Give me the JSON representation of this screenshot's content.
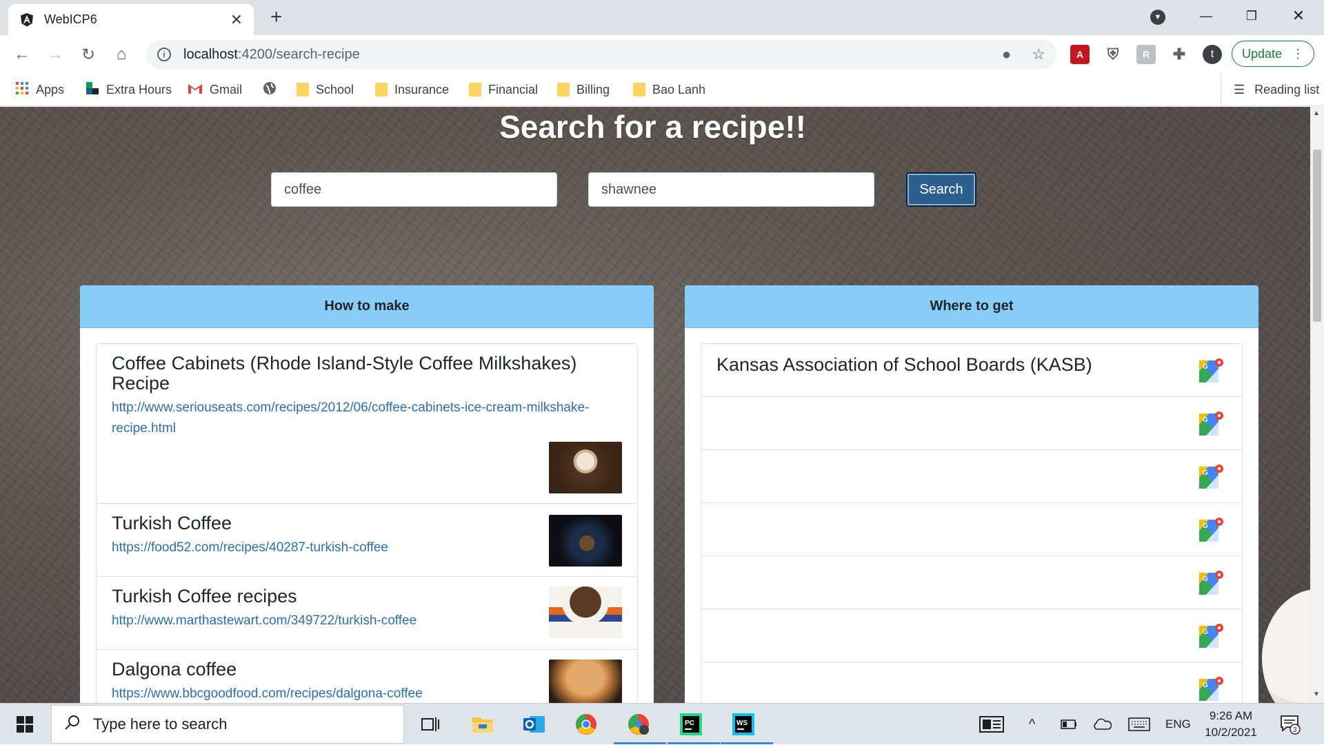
{
  "browser": {
    "tab_title": "WebICP6",
    "url_host": "localhost",
    "url_rest": ":4200/search-recipe",
    "update_label": "Update",
    "avatar_letter": "t"
  },
  "bookmarks": [
    {
      "label": "Apps",
      "icon": "apps-grid-icon"
    },
    {
      "label": "Extra Hours",
      "icon": "app-icon"
    },
    {
      "label": "Gmail",
      "icon": "gmail-icon"
    },
    {
      "label": "",
      "icon": "globe-icon"
    },
    {
      "label": "School",
      "icon": "folder-icon"
    },
    {
      "label": "Insurance",
      "icon": "folder-icon"
    },
    {
      "label": "Financial",
      "icon": "folder-icon"
    },
    {
      "label": "Billing",
      "icon": "folder-icon"
    },
    {
      "label": "Bao Lanh",
      "icon": "folder-icon"
    }
  ],
  "reading_list": "Reading list",
  "page": {
    "title": "Search for a recipe!!",
    "recipe_query": "coffee",
    "location_query": "shawnee",
    "search_label": "Search"
  },
  "how_to_make": {
    "header": "How to make",
    "recipes": [
      {
        "title": "Coffee Cabinets (Rhode Island-Style Coffee Milkshakes) Recipe",
        "url": "http://www.seriouseats.com/recipes/2012/06/coffee-cabinets-ice-cream-milkshake-recipe.html",
        "thumb": "milkshake-photo"
      },
      {
        "title": "Turkish Coffee",
        "url": "https://food52.com/recipes/40287-turkish-coffee",
        "thumb": "turkish-coffee-cup-photo"
      },
      {
        "title": "Turkish Coffee recipes",
        "url": "http://www.marthastewart.com/349722/turkish-coffee",
        "thumb": "coffee-cup-photo"
      },
      {
        "title": "Dalgona coffee",
        "url": "https://www.bbcgoodfood.com/recipes/dalgona-coffee",
        "thumb": "dalgona-photo"
      }
    ]
  },
  "where_to_get": {
    "header": "Where to get",
    "places": [
      {
        "name": "Kansas Association of School Boards (KASB)"
      },
      {
        "name": ""
      },
      {
        "name": ""
      },
      {
        "name": ""
      },
      {
        "name": ""
      },
      {
        "name": ""
      },
      {
        "name": ""
      }
    ]
  },
  "taskbar": {
    "search_placeholder": "Type here to search",
    "language": "ENG",
    "time": "9:26 AM",
    "date": "10/2/2021",
    "notifications": "3"
  },
  "colors": {
    "panel_header": "#87cdf7",
    "search_button": "#2c5f8c",
    "link": "#2a6fb0"
  }
}
